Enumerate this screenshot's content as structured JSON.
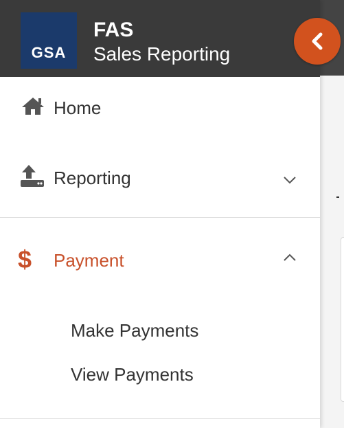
{
  "app": {
    "logo_text": "GSA",
    "title": "FAS",
    "subtitle": "Sales Reporting"
  },
  "colors": {
    "header_bg": "#3a3a3a",
    "logo_bg": "#1b3a6b",
    "accent": "#d2521e",
    "active_text": "#c8502a",
    "text": "#333333"
  },
  "collapse_button": {
    "icon": "chevron-left-icon"
  },
  "nav": {
    "items": [
      {
        "label": "Home",
        "icon": "home-icon"
      },
      {
        "label": "Reporting",
        "icon": "upload-icon",
        "expanded": false
      },
      {
        "label": "Payment",
        "icon": "dollar-icon",
        "icon_text": "$",
        "expanded": true,
        "subitems": [
          {
            "label": "Make Payments"
          },
          {
            "label": "View Payments"
          }
        ]
      }
    ]
  }
}
